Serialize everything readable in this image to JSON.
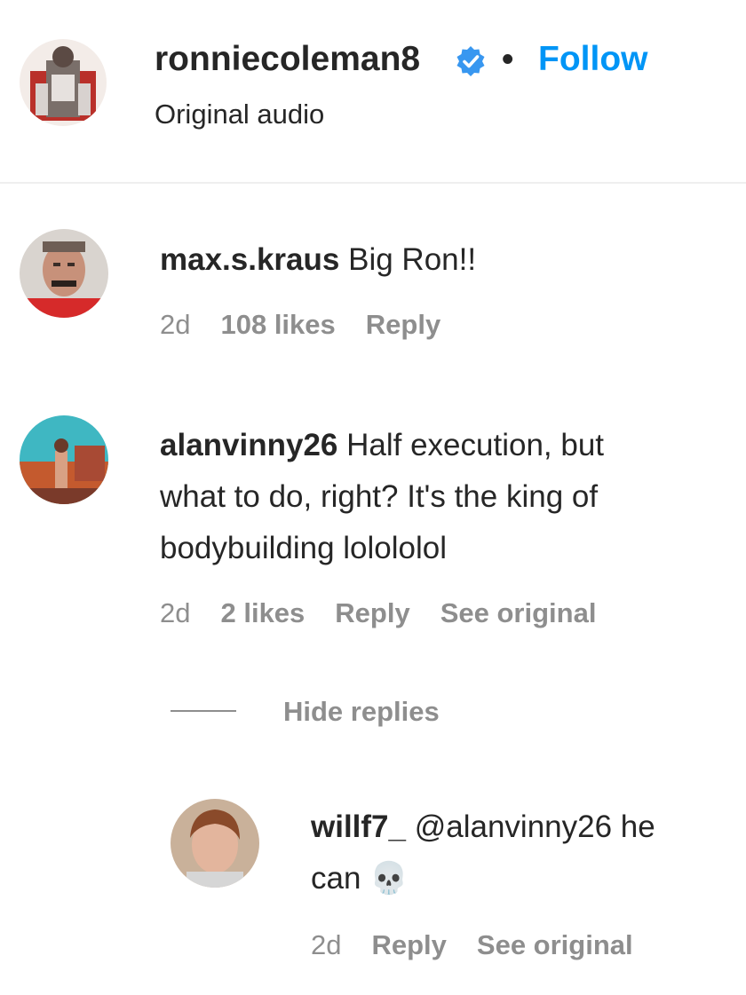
{
  "header": {
    "username": "ronniecoleman8",
    "separator": "•",
    "follow_label": "Follow",
    "subtitle": "Original audio"
  },
  "comments": [
    {
      "username": "max.s.kraus",
      "text": "Big Ron!!",
      "time": "2d",
      "likes": "108 likes",
      "reply_label": "Reply"
    },
    {
      "username": "alanvinny26",
      "text_line1": "Half execution, but",
      "text_line2": "what to do, right? It's the king of",
      "text_line3": "bodybuilding lolololol",
      "time": "2d",
      "likes": "2 likes",
      "reply_label": "Reply",
      "see_original_label": "See original"
    }
  ],
  "replies_toggle": {
    "label": "Hide replies"
  },
  "reply": {
    "username": "willf7_",
    "text_line1": "@alanvinny26 he",
    "text_line2": "can 💀",
    "time": "2d",
    "reply_label": "Reply",
    "see_original_label": "See original"
  },
  "colors": {
    "link_blue": "#0095f6",
    "verified_blue": "#3897f0",
    "muted": "#8e8e8e",
    "text": "#262626"
  },
  "icons": {
    "verified": "verified-badge-icon"
  }
}
